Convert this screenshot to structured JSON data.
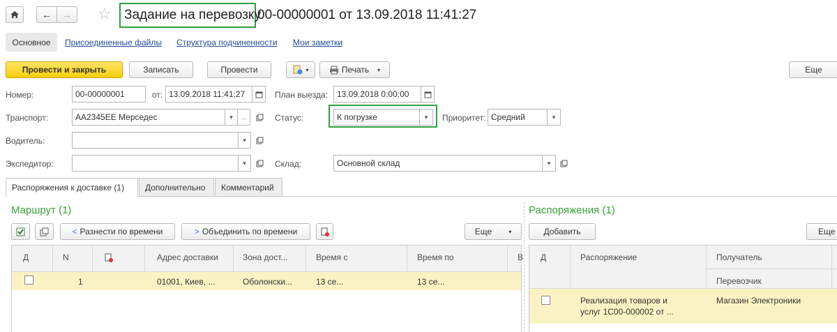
{
  "window": {
    "title": "Задание на перевозку",
    "title_suffix": "00-00000001 от 13.09.2018 11:41:27"
  },
  "nav_tabs": [
    "Основное",
    "Присоединенные файлы",
    "Структура подчиненности",
    "Мои заметки"
  ],
  "toolbar": {
    "post_close": "Провести и закрыть",
    "save": "Записать",
    "post": "Провести",
    "print": "Печать",
    "more": "Еще"
  },
  "form": {
    "number_label": "Номер:",
    "number_value": "00-00000001",
    "from_label": "от:",
    "from_value": "13.09.2018 11:41:27",
    "plan_label": "План выезда:",
    "plan_value": "13.09.2018  0:00:00",
    "transport_label": "Транспорт:",
    "transport_value": "АА2345ЕЕ Мерседес",
    "transport_dots": "...",
    "status_label": "Статус:",
    "status_value": "К погрузке",
    "priority_label": "Приоритет:",
    "priority_value": "Средний",
    "driver_label": "Водитель:",
    "driver_value": "",
    "forwarder_label": "Экспедитор:",
    "forwarder_value": "",
    "warehouse_label": "Склад:",
    "warehouse_value": "Основной склад"
  },
  "inner_tabs": [
    "Распоряжения к доставке (1)",
    "Дополнительно",
    "Комментарий"
  ],
  "route": {
    "title": "Маршрут (1)",
    "btn_distribute": "Разнести по времени",
    "btn_merge": "Объединить по времени",
    "btn_more": "Еще",
    "columns": [
      "Д",
      "N",
      "Адрес доставки",
      "Зона дост...",
      "Время с",
      "Время по",
      "В"
    ],
    "rows": [
      {
        "n": "1",
        "address": "01001, Киев, ...",
        "zone": "Оболонски...",
        "from": "13 се...",
        "to": "13 се..."
      }
    ]
  },
  "orders": {
    "title": "Распоряжения (1)",
    "btn_add": "Добавить",
    "btn_more": "Еще",
    "columns": [
      "Д",
      "Распоряжение",
      "Получатель",
      "Перевозчик"
    ],
    "rows": [
      {
        "order_line1": "Реализация товаров и",
        "order_line2": "услуг 1С00-000002 от ...",
        "recipient": "Магазин Электроники"
      }
    ]
  },
  "colors": {
    "accent_green": "#3aa239",
    "highlight_box": "#2ea043",
    "primary_button": "#f7cf0b",
    "selected_row": "#fbf2c4"
  }
}
